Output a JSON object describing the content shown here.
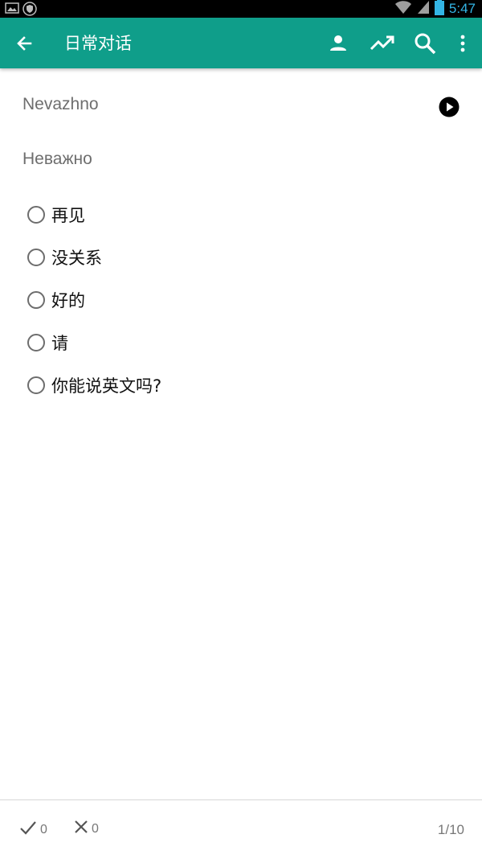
{
  "status_bar": {
    "time": "5:47",
    "icons": [
      "image-icon",
      "shield-icon",
      "wifi-icon",
      "signal-icon",
      "battery-icon"
    ]
  },
  "app_bar": {
    "title": "日常对话",
    "actions": [
      "person-icon",
      "trending-icon",
      "search-icon",
      "more-vert-icon"
    ],
    "color": "#0f9e8a"
  },
  "question": {
    "word": "Nevazhno",
    "translit": "Неважно"
  },
  "options": [
    {
      "label": "再见"
    },
    {
      "label": "没关系"
    },
    {
      "label": "好的"
    },
    {
      "label": "请"
    },
    {
      "label": "你能说英文吗?"
    }
  ],
  "footer": {
    "correct": "0",
    "wrong": "0",
    "progress": "1/10"
  }
}
